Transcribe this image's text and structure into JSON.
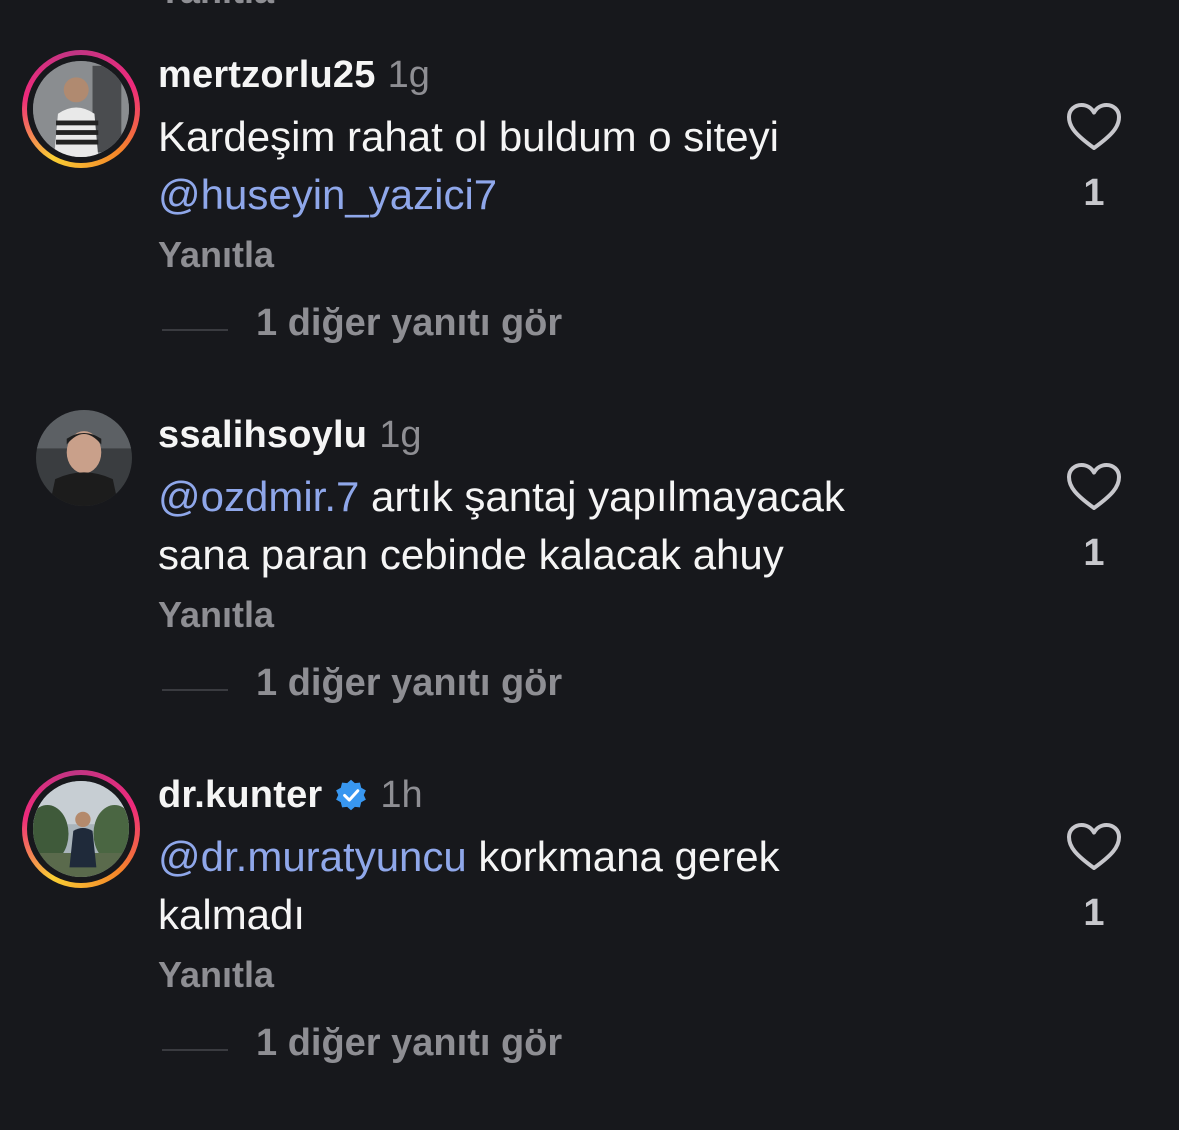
{
  "partial_top_label": "Yanıtla",
  "comments": [
    {
      "username": "mertzorlu25",
      "time": "1g",
      "verified": false,
      "mention": "",
      "text_line1": "Kardeşim rahat ol buldum o siteyi",
      "text_line2_mention": "@huseyin_yazici7",
      "text_line2": "",
      "reply_label": "Yanıtla",
      "more_replies": "1 diğer yanıtı gör",
      "like_count": "1",
      "avatar_icon": "avatar-photo",
      "has_story_ring": true
    },
    {
      "username": "ssalihsoylu",
      "time": "1g",
      "verified": false,
      "mention": "@ozdmir.7",
      "text_line1": " artık şantaj yapılmayacak",
      "text_line2": "sana paran cebinde kalacak ahuy",
      "reply_label": "Yanıtla",
      "more_replies": "1 diğer yanıtı gör",
      "like_count": "1",
      "avatar_icon": "avatar-photo",
      "has_story_ring": false
    },
    {
      "username": "dr.kunter",
      "time": "1h",
      "verified": true,
      "mention": "@dr.muratyuncu",
      "text_line1": " korkmana gerek",
      "text_line2": "kalmadı",
      "reply_label": "Yanıtla",
      "more_replies": "1 diğer yanıtı gör",
      "like_count": "1",
      "avatar_icon": "avatar-photo",
      "has_story_ring": true
    }
  ],
  "colors": {
    "background": "#17181c",
    "mention": "#8fa7ea",
    "muted": "#8e8e93",
    "verified": "#3897f0"
  }
}
